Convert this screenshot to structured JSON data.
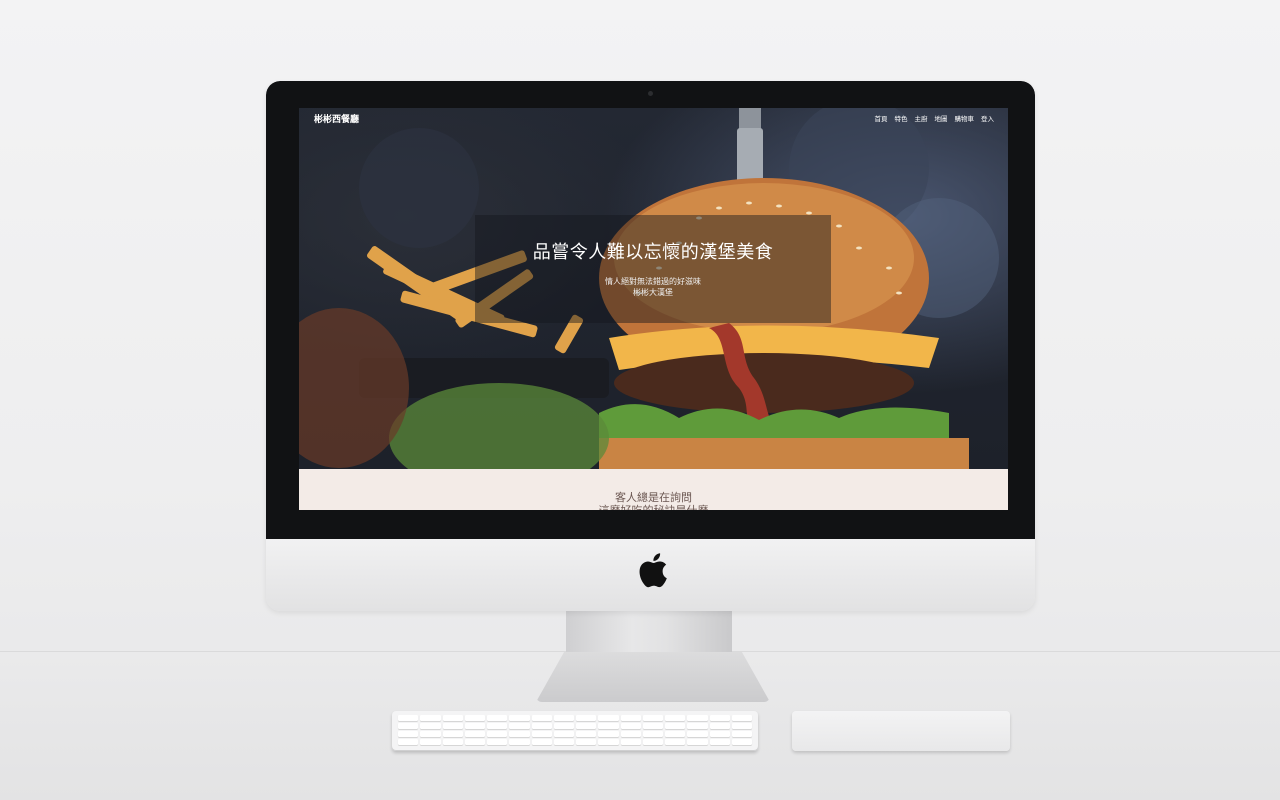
{
  "site": {
    "logo": "彬彬西餐廳",
    "nav": [
      "首頁",
      "特色",
      "主廚",
      "地圖",
      "購物車",
      "登入"
    ]
  },
  "hero": {
    "title": "品嘗令人難以忘懷的漢堡美食",
    "subtitle_line1": "情人絕對無法錯過的好滋味",
    "subtitle_line2": "彬彬大漢堡"
  },
  "section": {
    "line1": "客人總是在詢問",
    "line2": "這麼好吃的秘訣是什麼"
  },
  "colors": {
    "section_bg": "#f3ebe7",
    "section_text": "#6b5752",
    "hero_overlay": "rgba(20,22,28,0.45)"
  },
  "icons": [
    "apple-logo-icon"
  ]
}
